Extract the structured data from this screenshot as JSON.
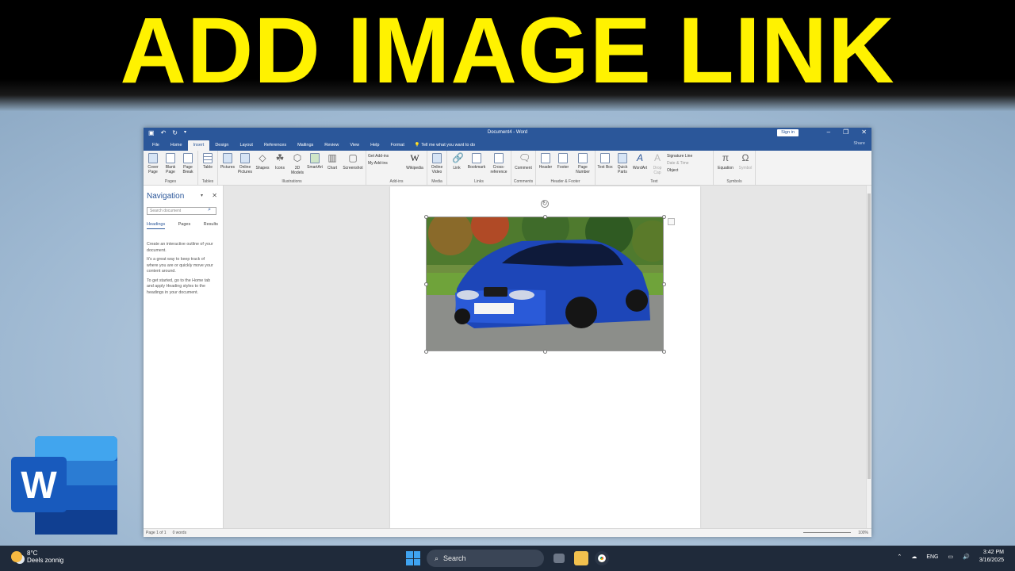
{
  "banner": {
    "title": "ADD IMAGE LINK"
  },
  "window": {
    "doc_title": "Document4 - Word",
    "sign_in": "Sign in",
    "share": "Share",
    "tabs": [
      "File",
      "Home",
      "Insert",
      "Design",
      "Layout",
      "References",
      "Mailings",
      "Review",
      "View",
      "Help",
      "Format"
    ],
    "active_tab": "Insert",
    "tell_me": "Tell me what you want to do"
  },
  "ribbon": {
    "groups": [
      {
        "label": "Pages",
        "buttons": [
          "Cover Page",
          "Blank Page",
          "Page Break"
        ]
      },
      {
        "label": "Tables",
        "buttons": [
          "Table"
        ]
      },
      {
        "label": "Illustrations",
        "buttons": [
          "Pictures",
          "Online Pictures",
          "Shapes",
          "Icons",
          "3D Models",
          "SmartArt",
          "Chart",
          "Screenshot"
        ]
      },
      {
        "label": "Add-ins",
        "small": [
          "Get Add-ins",
          "My Add-ins"
        ],
        "buttons": [
          "Wikipedia"
        ]
      },
      {
        "label": "Media",
        "buttons": [
          "Online Video"
        ]
      },
      {
        "label": "Links",
        "buttons": [
          "Link",
          "Bookmark",
          "Cross-reference"
        ]
      },
      {
        "label": "Comments",
        "buttons": [
          "Comment"
        ]
      },
      {
        "label": "Header & Footer",
        "buttons": [
          "Header",
          "Footer",
          "Page Number"
        ]
      },
      {
        "label": "Text",
        "buttons": [
          "Text Box",
          "Quick Parts",
          "WordArt",
          "Drop Cap"
        ],
        "small": [
          "Signature Line",
          "Date & Time",
          "Object"
        ]
      },
      {
        "label": "Symbols",
        "buttons": [
          "Equation",
          "Symbol"
        ]
      }
    ]
  },
  "navigation": {
    "title": "Navigation",
    "search_placeholder": "Search document",
    "tabs": [
      "Headings",
      "Pages",
      "Results"
    ],
    "text": [
      "Create an interactive outline of your document.",
      "It's a great way to keep track of where you are or quickly move your content around.",
      "To get started, go to the Home tab and apply Heading styles to the headings in your document."
    ]
  },
  "status": {
    "page": "Page 1 of 1",
    "words": "0 words",
    "zoom": "100%"
  },
  "taskbar": {
    "temp": "8°C",
    "weather": "Deels zonnig",
    "search": "Search",
    "lang": "ENG",
    "time": "3:42 PM",
    "date": "3/16/2025"
  },
  "colors": {
    "word_blue": "#2b579a",
    "banner_text": "#fff200"
  }
}
